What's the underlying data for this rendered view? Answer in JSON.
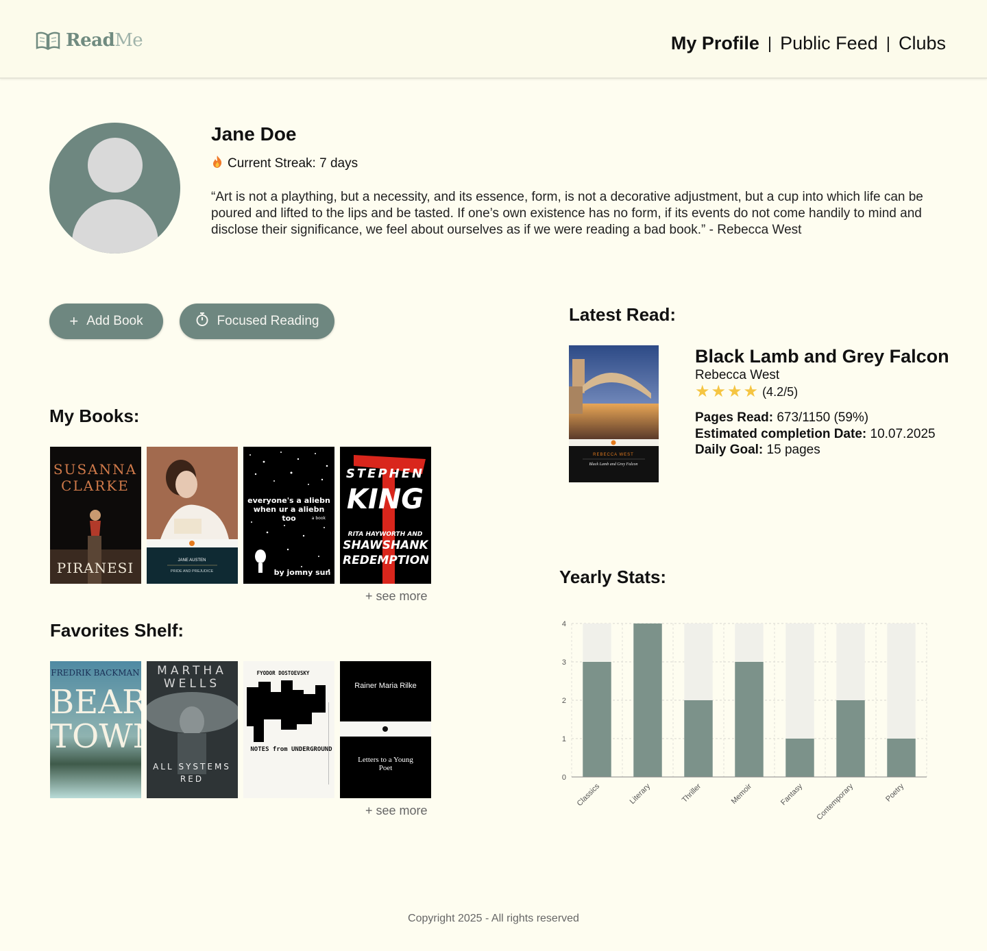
{
  "header": {
    "logo_read": "Read",
    "logo_me": "Me",
    "nav": [
      {
        "label": "My Profile",
        "active": true
      },
      {
        "label": "Public Feed",
        "active": false
      },
      {
        "label": "Clubs",
        "active": false
      }
    ],
    "separator": "|"
  },
  "profile": {
    "name": "Jane Doe",
    "streak_icon": "flame-icon",
    "streak": "Current Streak: 7 days",
    "quote": "“Art is not a plaything, but a necessity, and its essence, form, is not a decorative adjustment, but a cup into which life can be poured and lifted to the lips and be tasted. If one’s own existence has no form, if its events do not come handily to mind and disclose their significance, we feel about ourselves as if we were reading a bad book.” - Rebecca West"
  },
  "actions": {
    "add_book": "Add Book",
    "focused_reading": "Focused Reading"
  },
  "my_books": {
    "title": "My Books:",
    "see_more": "+ see more",
    "books": [
      {
        "top": "SUSANNA",
        "top2": "CLARKE",
        "bottom": "PIRANESI"
      },
      {
        "author": "JANE AUSTEN",
        "title": "PRIDE AND PREJUDICE"
      },
      {
        "title": "everyone's a aliebn when ur a aliebn too",
        "sub": "a book",
        "author": "by jomny sun"
      },
      {
        "top": "STEPHEN",
        "top2": "KING",
        "sub": "RITA HAYWORTH AND",
        "bottom": "SHAWSHANK REDEMPTION"
      }
    ]
  },
  "favorites": {
    "title": "Favorites Shelf:",
    "see_more": "+ see more",
    "books": [
      {
        "top": "FREDRIK BACKMAN",
        "bottom": "BEAR TOWN"
      },
      {
        "top": "MARTHA",
        "top2": "WELLS",
        "bottom": "ALL SYSTEMS",
        "bottom2": "RED"
      },
      {
        "top": "FYODOR DOSTOEVSKY",
        "bottom": "NOTES from UNDERGROUND"
      },
      {
        "top": "Rainer Maria Rilke",
        "bottom": "Letters to a Young Poet"
      }
    ]
  },
  "latest_read": {
    "heading": "Latest Read:",
    "title": "Black Lamb and Grey Falcon",
    "author": "Rebecca West",
    "rating": 4.2,
    "rating_text": "(4.2/5)",
    "cover_author": "REBECCA WEST",
    "cover_title": "Black Lamb and Grey Falcon",
    "pages_label": "Pages Read:",
    "pages_value": "673/1150 (59%)",
    "completion_label": "Estimated completion Date:",
    "completion_value": "10.07.2025",
    "goal_label": "Daily Goal:",
    "goal_value": "15 pages"
  },
  "yearly_stats": {
    "heading": "Yearly Stats:"
  },
  "chart_data": {
    "type": "bar",
    "categories": [
      "Classics",
      "Literary",
      "Thriller",
      "Memoir",
      "Fantasy",
      "Contemporary",
      "Poetry"
    ],
    "values": [
      3,
      4,
      2,
      3,
      1,
      2,
      1
    ],
    "ylim": [
      0,
      4
    ],
    "yticks": [
      0,
      1,
      2,
      3,
      4
    ],
    "grid": true,
    "colors": {
      "bar": "#7c928a",
      "background_bar": "#f0f0ea"
    }
  },
  "footer": {
    "copyright": "Copyright 2025 - All rights reserved"
  }
}
